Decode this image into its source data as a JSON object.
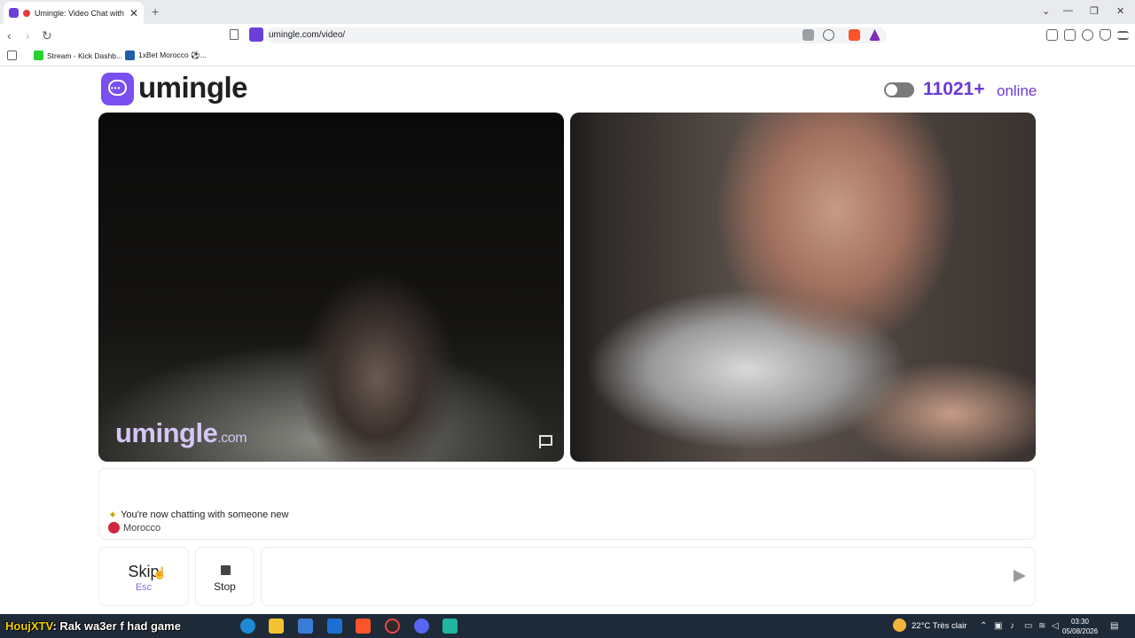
{
  "browser": {
    "tab_title": "Umingle: Video Chat with Strangers",
    "new_tab": "+",
    "url": "umingle.com/video/",
    "bookmarks": [
      {
        "label": "Stream - Kick Dashb...",
        "color": "#27d22f"
      },
      {
        "label": "1xBet Morocco ⚽...",
        "color": "#1f5fa8"
      }
    ],
    "window_controls": [
      "⌄",
      "—",
      "❐",
      "✕"
    ]
  },
  "header": {
    "logo": "umingle",
    "online_count": "11021+",
    "online_label": "online"
  },
  "video": {
    "watermark": "umingle",
    "watermark_suffix": ".com"
  },
  "chat": {
    "status_message": "You're now chatting with someone new",
    "country": "Morocco"
  },
  "controls": {
    "skip_label": "Skip",
    "skip_key": "Esc",
    "stop_label": "Stop"
  },
  "taskbar": {
    "overlay_nick": "HoujXTV",
    "overlay_message": ": Rak wa3er f had game",
    "weather": "22°C  Très clair",
    "time": "03:30",
    "date": "05/08/2026"
  },
  "colors": {
    "brand": "#7a4ff0",
    "online_text": "#6a3ad8",
    "taskbar": "#1e2a38"
  }
}
